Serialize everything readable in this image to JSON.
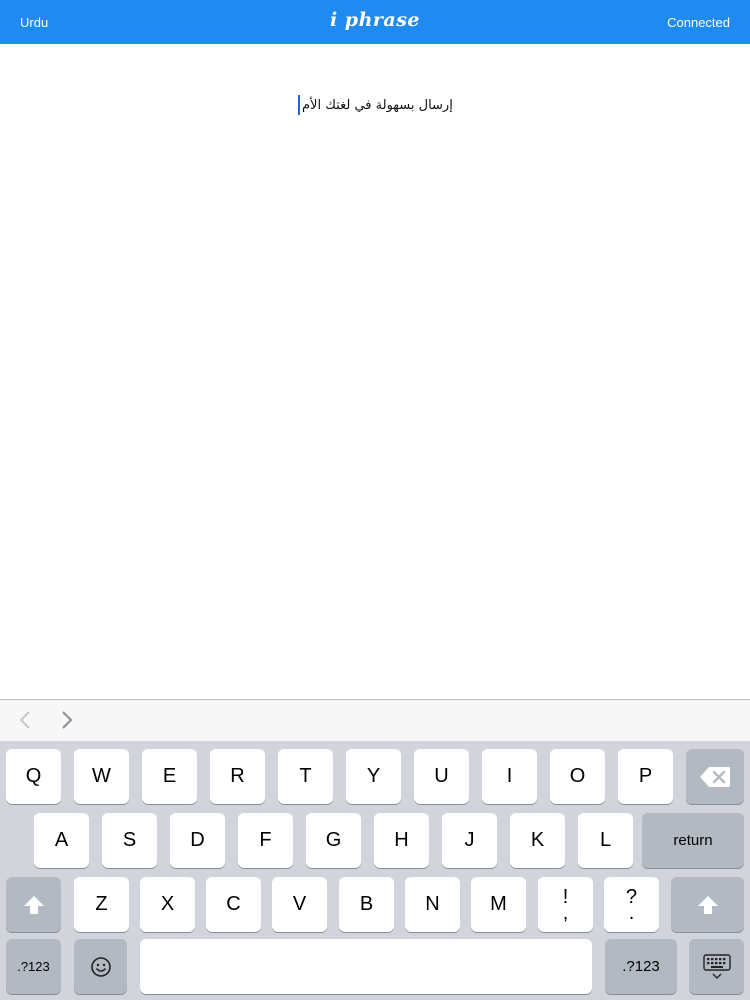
{
  "navbar": {
    "left_label": "Urdu",
    "title": "i phrase",
    "right_label": "Connected",
    "color": "#1f8bf0"
  },
  "editor": {
    "text": "إرسال بسهولة في لغتك الأم"
  },
  "accessory": {
    "back_icon": "chevron-left-icon",
    "forward_icon": "chevron-right-icon"
  },
  "keyboard": {
    "row1": [
      "Q",
      "W",
      "E",
      "R",
      "T",
      "Y",
      "U",
      "I",
      "O",
      "P"
    ],
    "row2": [
      "A",
      "S",
      "D",
      "F",
      "G",
      "H",
      "J",
      "K",
      "L"
    ],
    "row3": [
      "Z",
      "X",
      "C",
      "V",
      "B",
      "N",
      "M"
    ],
    "return_label": "return",
    "numbers_label": ".?123",
    "punct1_top": "!",
    "punct1_bottom": ",",
    "punct2_top": "?",
    "punct2_bottom": ".",
    "delete_icon": "backspace-icon",
    "shift_icon": "shift-icon",
    "emoji_icon": "emoji-icon",
    "hide_keyboard_icon": "keyboard-hide-icon"
  }
}
